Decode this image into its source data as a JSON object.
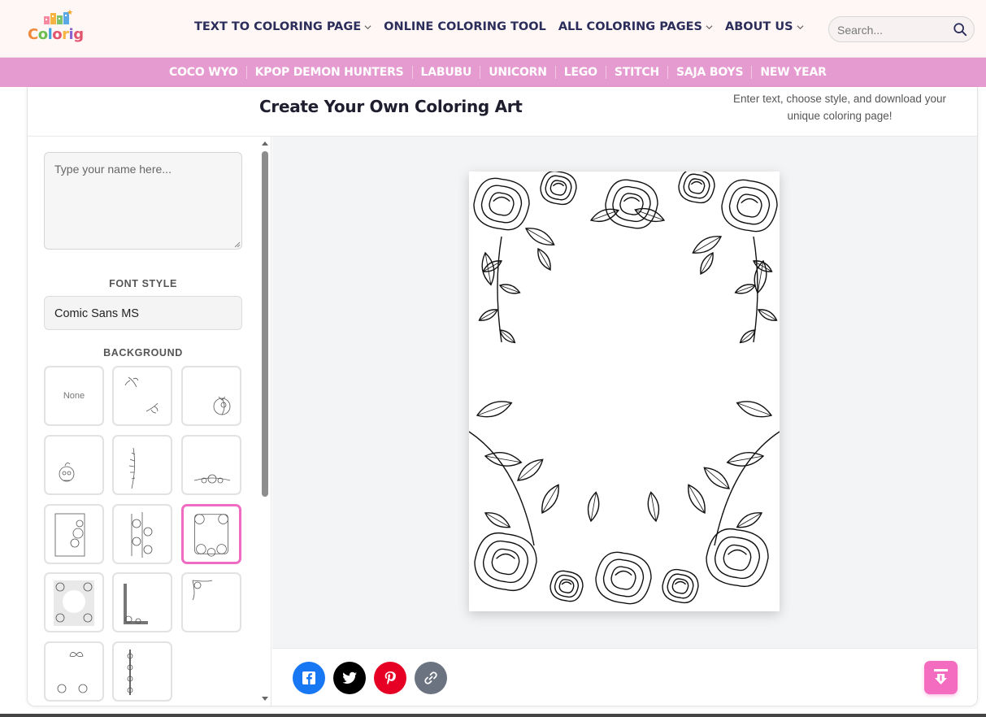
{
  "header": {
    "logo_text": "Colorig",
    "nav": [
      {
        "label": "TEXT TO COLORING PAGE",
        "has_dropdown": true
      },
      {
        "label": "ONLINE COLORING TOOL",
        "has_dropdown": false
      },
      {
        "label": "ALL COLORING PAGES",
        "has_dropdown": true
      },
      {
        "label": "ABOUT US",
        "has_dropdown": true
      }
    ],
    "search_placeholder": "Search..."
  },
  "categories": [
    "COCO WYO",
    "KPOP DEMON HUNTERS",
    "LABUBU",
    "UNICORN",
    "LEGO",
    "STITCH",
    "SAJA BOYS",
    "NEW YEAR"
  ],
  "card": {
    "title": "Create Your Own Coloring Art",
    "subtitle": "Enter text, choose style, and download your unique coloring page!"
  },
  "panel": {
    "name_placeholder": "Type your name here...",
    "font_style_label": "FONT STYLE",
    "font_value": "Comic Sans MS",
    "background_label": "BACKGROUND",
    "none_label": "None",
    "backgrounds": [
      {
        "name": "none"
      },
      {
        "name": "corner-sprigs"
      },
      {
        "name": "moon-flower"
      },
      {
        "name": "skull-flower"
      },
      {
        "name": "lavender-vine"
      },
      {
        "name": "flower-garland"
      },
      {
        "name": "frame-roses"
      },
      {
        "name": "double-rose-border"
      },
      {
        "name": "rose-frame",
        "selected": true
      },
      {
        "name": "dense-floral-wreath"
      },
      {
        "name": "corner-floral-L"
      },
      {
        "name": "corner-vine"
      },
      {
        "name": "butterfly-corners"
      },
      {
        "name": "side-vine"
      }
    ]
  },
  "share": [
    {
      "name": "facebook",
      "color": "#1877f2"
    },
    {
      "name": "twitter",
      "color": "#000000"
    },
    {
      "name": "pinterest",
      "color": "#e60023"
    },
    {
      "name": "copy-link",
      "color": "#6b7280"
    }
  ],
  "colors": {
    "nav_text": "#2b2d5a",
    "category_bar": "#e59bd0",
    "accent_pink": "#f46cc0",
    "selected_border": "#f06bc2"
  }
}
